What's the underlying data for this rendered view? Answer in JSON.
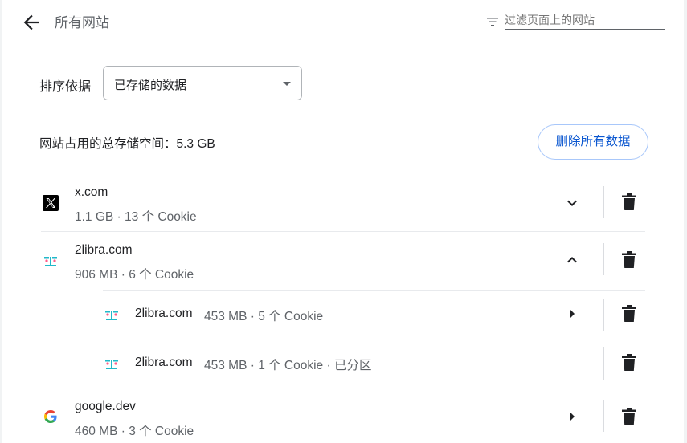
{
  "header": {
    "title": "所有网站",
    "filter_placeholder": "过滤页面上的网站"
  },
  "sort": {
    "label": "排序依据",
    "selected": "已存储的数据"
  },
  "storage": {
    "total_text": "网站占用的总存储空间：5.3 GB",
    "delete_all_label": "删除所有数据"
  },
  "sites": [
    {
      "name": "x.com",
      "meta": "1.1 GB · 13 个 Cookie",
      "icon": "x-logo-icon",
      "state": "collapsed"
    },
    {
      "name": "2libra.com",
      "meta": "906 MB · 6 个 Cookie",
      "icon": "2libra-favicon-icon",
      "state": "expanded",
      "children": [
        {
          "name": "2libra.com",
          "meta": "453 MB · 5 个 Cookie"
        },
        {
          "name": "2libra.com",
          "meta": "453 MB · 1 个 Cookie · 已分区"
        }
      ]
    },
    {
      "name": "google.dev",
      "meta": "460 MB · 3 个 Cookie",
      "icon": "google-g-icon",
      "state": "navigable"
    }
  ]
}
